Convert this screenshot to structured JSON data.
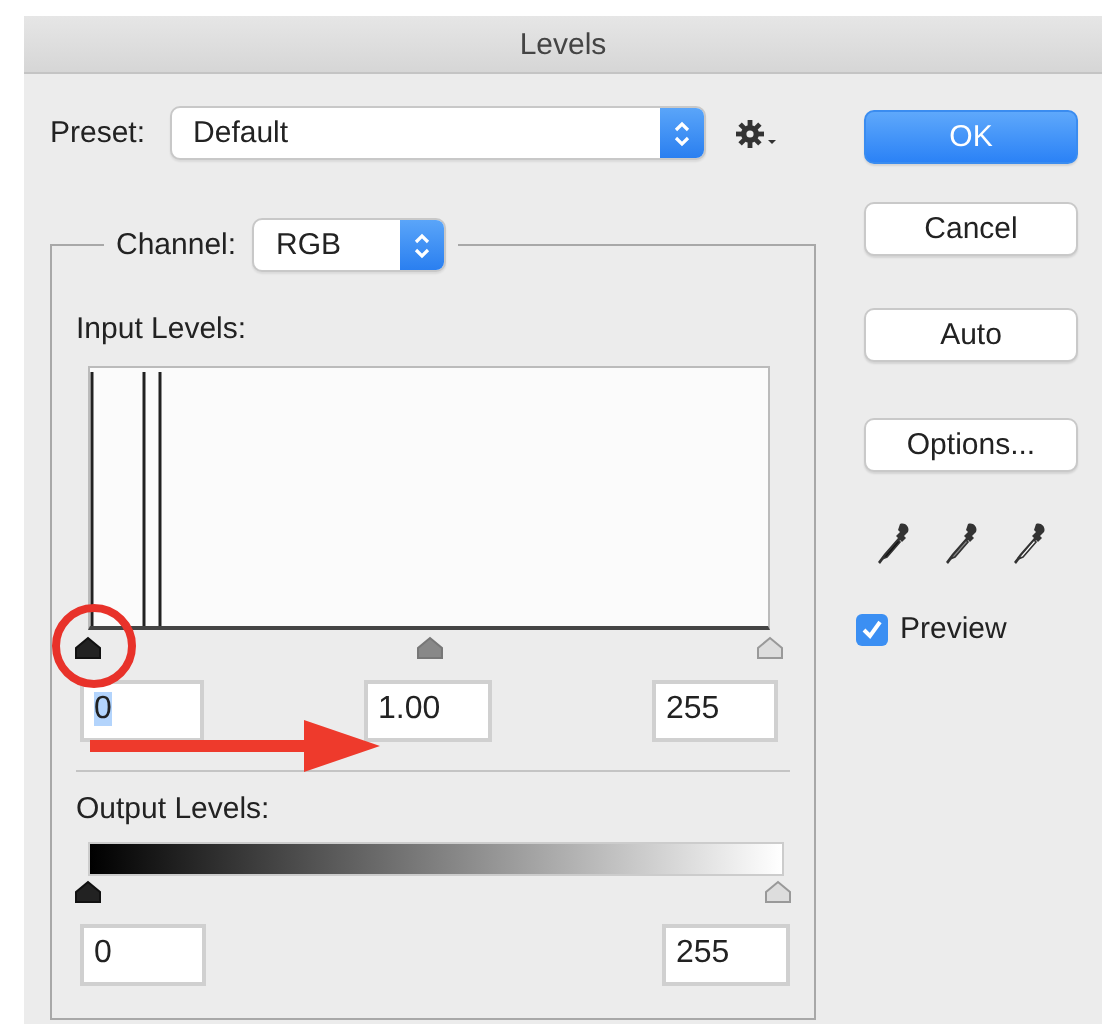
{
  "window": {
    "title": "Levels"
  },
  "preset": {
    "label": "Preset:",
    "value": "Default"
  },
  "channel": {
    "label": "Channel:",
    "value": "RGB"
  },
  "input_levels": {
    "label": "Input Levels:",
    "sliders": [
      {
        "kind": "black",
        "level": 0
      },
      {
        "kind": "gray",
        "level": 0.5
      },
      {
        "kind": "white",
        "level": 1
      }
    ],
    "fields": [
      {
        "value": "0",
        "selected": true
      },
      {
        "value": "1.00",
        "selected": false
      },
      {
        "value": "255",
        "selected": false
      }
    ]
  },
  "output_levels": {
    "label": "Output Levels:",
    "sliders": [
      {
        "kind": "black",
        "level": 0
      },
      {
        "kind": "white",
        "level": 1
      }
    ],
    "fields": [
      {
        "value": "0",
        "selected": false
      },
      {
        "value": "255",
        "selected": false
      }
    ]
  },
  "buttons": [
    {
      "label": "OK",
      "kind": "default"
    },
    {
      "label": "Cancel",
      "kind": "normal"
    },
    {
      "label": "Auto",
      "kind": "normal"
    },
    {
      "label": "Options...",
      "kind": "normal"
    }
  ],
  "eyedroppers": [
    {
      "kind": "black"
    },
    {
      "kind": "gray"
    },
    {
      "kind": "white"
    }
  ],
  "preview": {
    "label": "Preview",
    "checked": true
  },
  "annotations": [
    {
      "kind": "circle"
    },
    {
      "kind": "arrow"
    }
  ]
}
